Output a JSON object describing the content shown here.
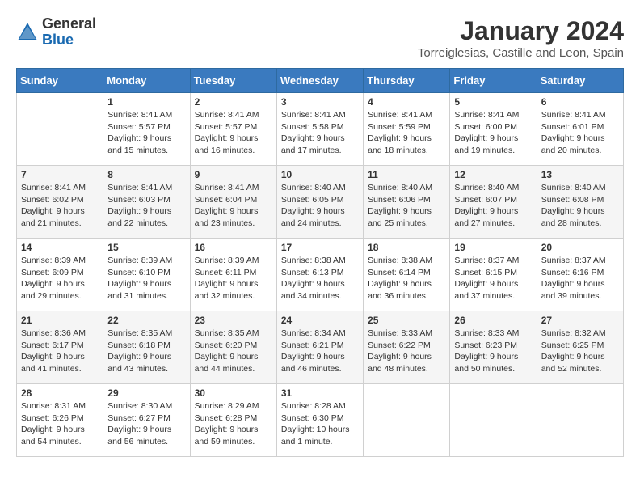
{
  "header": {
    "logo_general": "General",
    "logo_blue": "Blue",
    "title": "January 2024",
    "subtitle": "Torreiglesias, Castille and Leon, Spain"
  },
  "columns": [
    "Sunday",
    "Monday",
    "Tuesday",
    "Wednesday",
    "Thursday",
    "Friday",
    "Saturday"
  ],
  "weeks": [
    [
      {
        "day": "",
        "content": ""
      },
      {
        "day": "1",
        "content": "Sunrise: 8:41 AM\nSunset: 5:57 PM\nDaylight: 9 hours\nand 15 minutes."
      },
      {
        "day": "2",
        "content": "Sunrise: 8:41 AM\nSunset: 5:57 PM\nDaylight: 9 hours\nand 16 minutes."
      },
      {
        "day": "3",
        "content": "Sunrise: 8:41 AM\nSunset: 5:58 PM\nDaylight: 9 hours\nand 17 minutes."
      },
      {
        "day": "4",
        "content": "Sunrise: 8:41 AM\nSunset: 5:59 PM\nDaylight: 9 hours\nand 18 minutes."
      },
      {
        "day": "5",
        "content": "Sunrise: 8:41 AM\nSunset: 6:00 PM\nDaylight: 9 hours\nand 19 minutes."
      },
      {
        "day": "6",
        "content": "Sunrise: 8:41 AM\nSunset: 6:01 PM\nDaylight: 9 hours\nand 20 minutes."
      }
    ],
    [
      {
        "day": "7",
        "content": "Sunrise: 8:41 AM\nSunset: 6:02 PM\nDaylight: 9 hours\nand 21 minutes."
      },
      {
        "day": "8",
        "content": "Sunrise: 8:41 AM\nSunset: 6:03 PM\nDaylight: 9 hours\nand 22 minutes."
      },
      {
        "day": "9",
        "content": "Sunrise: 8:41 AM\nSunset: 6:04 PM\nDaylight: 9 hours\nand 23 minutes."
      },
      {
        "day": "10",
        "content": "Sunrise: 8:40 AM\nSunset: 6:05 PM\nDaylight: 9 hours\nand 24 minutes."
      },
      {
        "day": "11",
        "content": "Sunrise: 8:40 AM\nSunset: 6:06 PM\nDaylight: 9 hours\nand 25 minutes."
      },
      {
        "day": "12",
        "content": "Sunrise: 8:40 AM\nSunset: 6:07 PM\nDaylight: 9 hours\nand 27 minutes."
      },
      {
        "day": "13",
        "content": "Sunrise: 8:40 AM\nSunset: 6:08 PM\nDaylight: 9 hours\nand 28 minutes."
      }
    ],
    [
      {
        "day": "14",
        "content": "Sunrise: 8:39 AM\nSunset: 6:09 PM\nDaylight: 9 hours\nand 29 minutes."
      },
      {
        "day": "15",
        "content": "Sunrise: 8:39 AM\nSunset: 6:10 PM\nDaylight: 9 hours\nand 31 minutes."
      },
      {
        "day": "16",
        "content": "Sunrise: 8:39 AM\nSunset: 6:11 PM\nDaylight: 9 hours\nand 32 minutes."
      },
      {
        "day": "17",
        "content": "Sunrise: 8:38 AM\nSunset: 6:13 PM\nDaylight: 9 hours\nand 34 minutes."
      },
      {
        "day": "18",
        "content": "Sunrise: 8:38 AM\nSunset: 6:14 PM\nDaylight: 9 hours\nand 36 minutes."
      },
      {
        "day": "19",
        "content": "Sunrise: 8:37 AM\nSunset: 6:15 PM\nDaylight: 9 hours\nand 37 minutes."
      },
      {
        "day": "20",
        "content": "Sunrise: 8:37 AM\nSunset: 6:16 PM\nDaylight: 9 hours\nand 39 minutes."
      }
    ],
    [
      {
        "day": "21",
        "content": "Sunrise: 8:36 AM\nSunset: 6:17 PM\nDaylight: 9 hours\nand 41 minutes."
      },
      {
        "day": "22",
        "content": "Sunrise: 8:35 AM\nSunset: 6:18 PM\nDaylight: 9 hours\nand 43 minutes."
      },
      {
        "day": "23",
        "content": "Sunrise: 8:35 AM\nSunset: 6:20 PM\nDaylight: 9 hours\nand 44 minutes."
      },
      {
        "day": "24",
        "content": "Sunrise: 8:34 AM\nSunset: 6:21 PM\nDaylight: 9 hours\nand 46 minutes."
      },
      {
        "day": "25",
        "content": "Sunrise: 8:33 AM\nSunset: 6:22 PM\nDaylight: 9 hours\nand 48 minutes."
      },
      {
        "day": "26",
        "content": "Sunrise: 8:33 AM\nSunset: 6:23 PM\nDaylight: 9 hours\nand 50 minutes."
      },
      {
        "day": "27",
        "content": "Sunrise: 8:32 AM\nSunset: 6:25 PM\nDaylight: 9 hours\nand 52 minutes."
      }
    ],
    [
      {
        "day": "28",
        "content": "Sunrise: 8:31 AM\nSunset: 6:26 PM\nDaylight: 9 hours\nand 54 minutes."
      },
      {
        "day": "29",
        "content": "Sunrise: 8:30 AM\nSunset: 6:27 PM\nDaylight: 9 hours\nand 56 minutes."
      },
      {
        "day": "30",
        "content": "Sunrise: 8:29 AM\nSunset: 6:28 PM\nDaylight: 9 hours\nand 59 minutes."
      },
      {
        "day": "31",
        "content": "Sunrise: 8:28 AM\nSunset: 6:30 PM\nDaylight: 10 hours\nand 1 minute."
      },
      {
        "day": "",
        "content": ""
      },
      {
        "day": "",
        "content": ""
      },
      {
        "day": "",
        "content": ""
      }
    ]
  ]
}
